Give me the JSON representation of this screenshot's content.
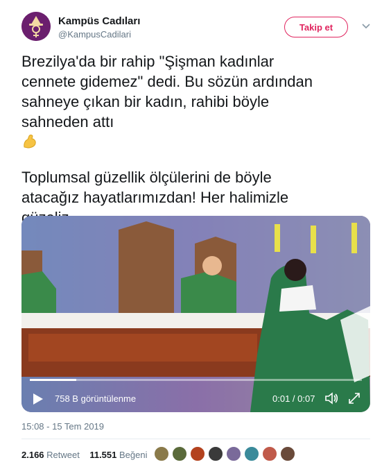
{
  "account": {
    "name": "Kampüs Cadıları",
    "handle": "@KampusCadilari",
    "follow_label": "Takip et",
    "avatar_color": "#6b1f6e",
    "icons": [
      "witch-avatar-icon",
      "chevron-down-icon"
    ]
  },
  "tweet": {
    "paragraph1": "Brezilya'da bir rahip \"Şişman kadınlar\ncennete gidemez\" dedi. Bu sözün ardından\nsahneye çıkan bir kadın, rahibi böyle\nsahneden attı",
    "emoji": "flexed-biceps-icon",
    "paragraph2": "Toplumsal güzellik ölçülerini de böyle\natacağız hayatlarımızdan! Her halimizle\ngüzeliz."
  },
  "video": {
    "views": "758 B görüntülenme",
    "time": "0:01 / 0:07",
    "progress": 0.14,
    "icons": [
      "play-icon",
      "volume-icon",
      "fullscreen-icon"
    ]
  },
  "meta": {
    "timestamp": "15:08 - 15 Tem 2019"
  },
  "stats": {
    "retweet_count": "2.166",
    "retweet_label": "Retweet",
    "like_count": "11.551",
    "like_label": "Beğeni",
    "liker_colors": [
      "#8a7a4a",
      "#5a6a3a",
      "#b3421e",
      "#3a3a3a",
      "#7a6a9a",
      "#3a8a9a",
      "#c05a4a",
      "#6a4a3a"
    ]
  },
  "colors": {
    "accent": "#e0245e",
    "text": "#14171a",
    "secondary": "#657786"
  }
}
